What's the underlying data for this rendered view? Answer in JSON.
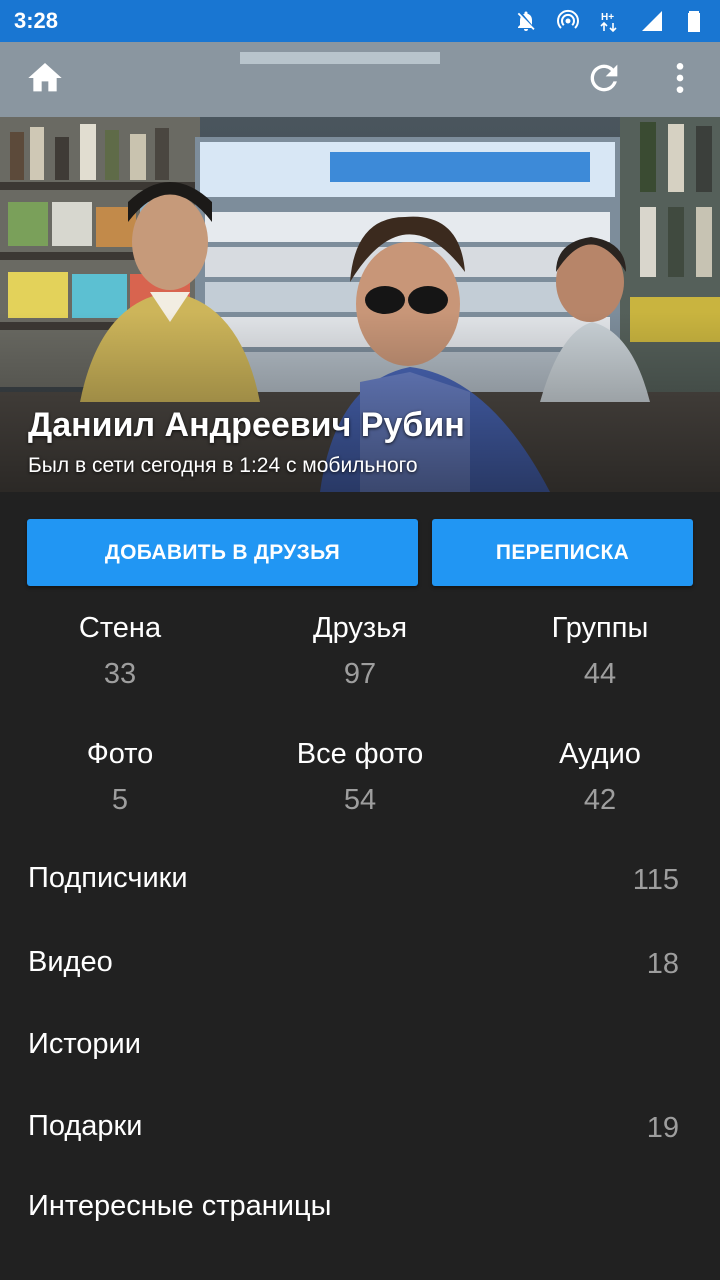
{
  "status_bar": {
    "time": "3:28",
    "icons": [
      "notifications-off-icon",
      "hotspot-icon",
      "network-hplus-icon",
      "signal-icon",
      "battery-icon"
    ]
  },
  "header": {
    "name": "Даниил Андреевич Рубин",
    "status": "Был в сети сегодня в 1:24 с мобильного",
    "icons": [
      "home-icon",
      "refresh-icon",
      "more-vert-icon"
    ]
  },
  "actions": {
    "add_friend": "ДОБАВИТЬ В ДРУЗЬЯ",
    "messages": "ПЕРЕПИСКА"
  },
  "stats": [
    {
      "label": "Стена",
      "count": "33"
    },
    {
      "label": "Друзья",
      "count": "97"
    },
    {
      "label": "Группы",
      "count": "44"
    },
    {
      "label": "Фото",
      "count": "5"
    },
    {
      "label": "Все фото",
      "count": "54"
    },
    {
      "label": "Аудио",
      "count": "42"
    }
  ],
  "list": [
    {
      "label": "Подписчики",
      "count": "115"
    },
    {
      "label": "Видео",
      "count": "18"
    },
    {
      "label": "Истории",
      "count": ""
    },
    {
      "label": "Подарки",
      "count": "19"
    },
    {
      "label": "Интересные страницы",
      "count": ""
    }
  ],
  "colors": {
    "status_bar": "#1976d2",
    "accent_button": "#2196f3",
    "background": "#212121",
    "muted_text": "#9e9e9e"
  }
}
